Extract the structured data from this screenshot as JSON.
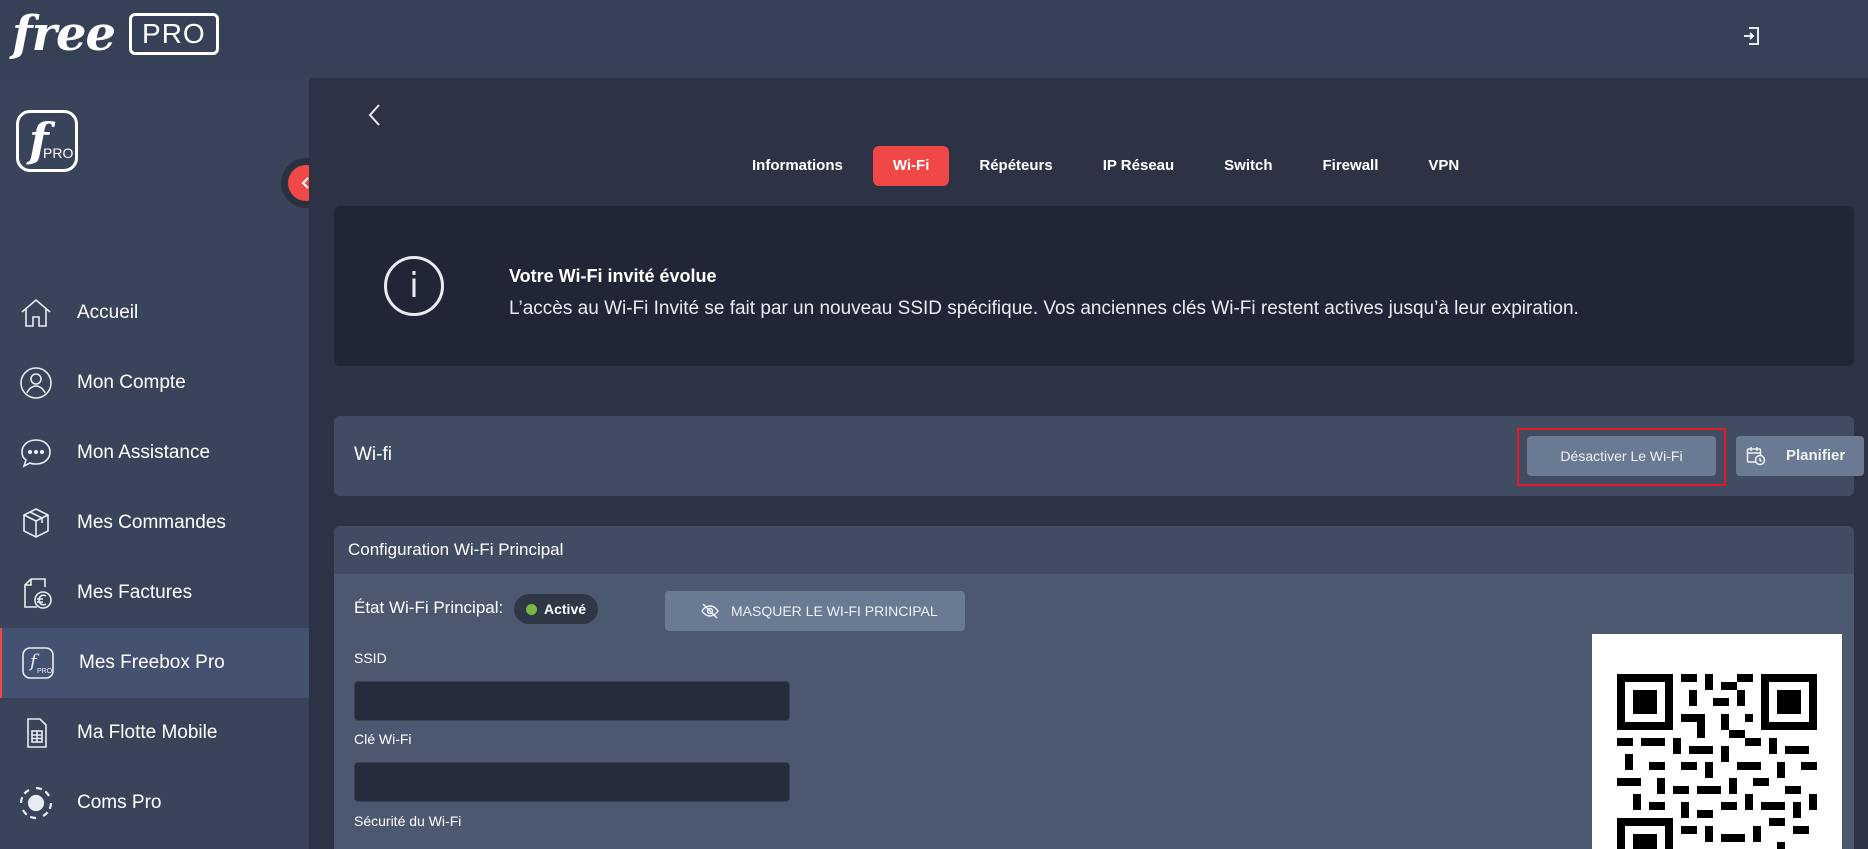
{
  "header": {
    "brand_word": "free",
    "brand_badge": "PRO",
    "logout_icon": "logout-icon"
  },
  "sidebar": {
    "logo_letter": "f",
    "logo_sub": "PRO",
    "collapse_icon": "chevron-left-icon",
    "items": [
      {
        "label": "Accueil",
        "icon": "home-icon"
      },
      {
        "label": "Mon Compte",
        "icon": "user-icon"
      },
      {
        "label": "Mon Assistance",
        "icon": "chat-icon"
      },
      {
        "label": "Mes Commandes",
        "icon": "package-icon"
      },
      {
        "label": "Mes Factures",
        "icon": "invoice-euro-icon"
      },
      {
        "label": "Mes Freebox Pro",
        "icon": "freebox-pro-icon",
        "active": true
      },
      {
        "label": "Ma Flotte Mobile",
        "icon": "sim-card-icon"
      },
      {
        "label": "Coms Pro",
        "icon": "phone-circle-icon"
      }
    ]
  },
  "main": {
    "back_icon": "chevron-left-icon",
    "tabs": [
      {
        "label": "Informations"
      },
      {
        "label": "Wi-Fi",
        "active": true
      },
      {
        "label": "Répéteurs"
      },
      {
        "label": "IP Réseau"
      },
      {
        "label": "Switch"
      },
      {
        "label": "Firewall"
      },
      {
        "label": "VPN"
      }
    ],
    "notice": {
      "icon": "info-icon",
      "icon_glyph": "i",
      "title": "Votre Wi-Fi invité évolue",
      "text": "L’accès au Wi-Fi Invité se fait par un nouveau SSID spécifique. Vos anciennes clés Wi-Fi restent actives jusqu’à leur expiration."
    },
    "wifi_bar": {
      "title": "Wi-fi",
      "disable_label": "Désactiver Le Wi-Fi",
      "schedule_label": "Planifier",
      "schedule_icon": "calendar-clock-icon"
    },
    "config": {
      "title": "Configuration Wi-Fi Principal",
      "state_label": "État Wi-Fi Principal:",
      "state_value": "Activé",
      "state_color": "#78b641",
      "mask_label": "MASQUER LE WI-FI PRINCIPAL",
      "mask_icon": "eye-off-icon",
      "ssid_label": "SSID",
      "ssid_value": "",
      "key_label": "Clé Wi-Fi",
      "key_value": "",
      "security_label": "Sécurité du Wi-Fi",
      "qr_icon": "qr-code-icon"
    }
  },
  "colors": {
    "accent": "#ef4846",
    "header_bg": "#364157",
    "sidebar_bg": "#394359",
    "main_bg": "#2d3344",
    "highlight": "#e21b22"
  }
}
